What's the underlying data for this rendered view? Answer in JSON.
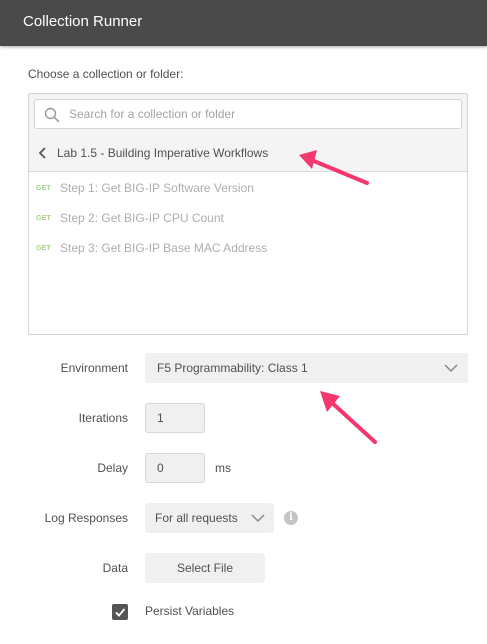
{
  "window": {
    "title": "Collection Runner"
  },
  "picker": {
    "label": "Choose a collection or folder:",
    "search_placeholder": "Search for a collection or folder",
    "breadcrumb": "Lab 1.5 - Building Imperative Workflows",
    "requests": [
      {
        "method": "GET",
        "name": "Step 1: Get BIG-IP Software Version"
      },
      {
        "method": "GET",
        "name": "Step 2: Get BIG-IP CPU Count"
      },
      {
        "method": "GET",
        "name": "Step 3: Get BIG-IP Base MAC Address"
      }
    ]
  },
  "form": {
    "environment_label": "Environment",
    "environment_value": "F5 Programmability: Class 1",
    "iterations_label": "Iterations",
    "iterations_value": "1",
    "delay_label": "Delay",
    "delay_value": "0",
    "delay_unit": "ms",
    "log_label": "Log Responses",
    "log_value": "For all requests",
    "data_label": "Data",
    "select_file_label": "Select File",
    "persist_label": "Persist Variables",
    "persist_checked": true
  },
  "colors": {
    "titlebar": "#4a4a4a",
    "method_get": "#a6d18b",
    "annotation_arrow": "#f5376e",
    "checkbox": "#555555"
  },
  "icons": [
    "search-icon",
    "chevron-left-icon",
    "chevron-down-icon",
    "info-icon",
    "checkmark-icon",
    "annotation-arrow"
  ]
}
